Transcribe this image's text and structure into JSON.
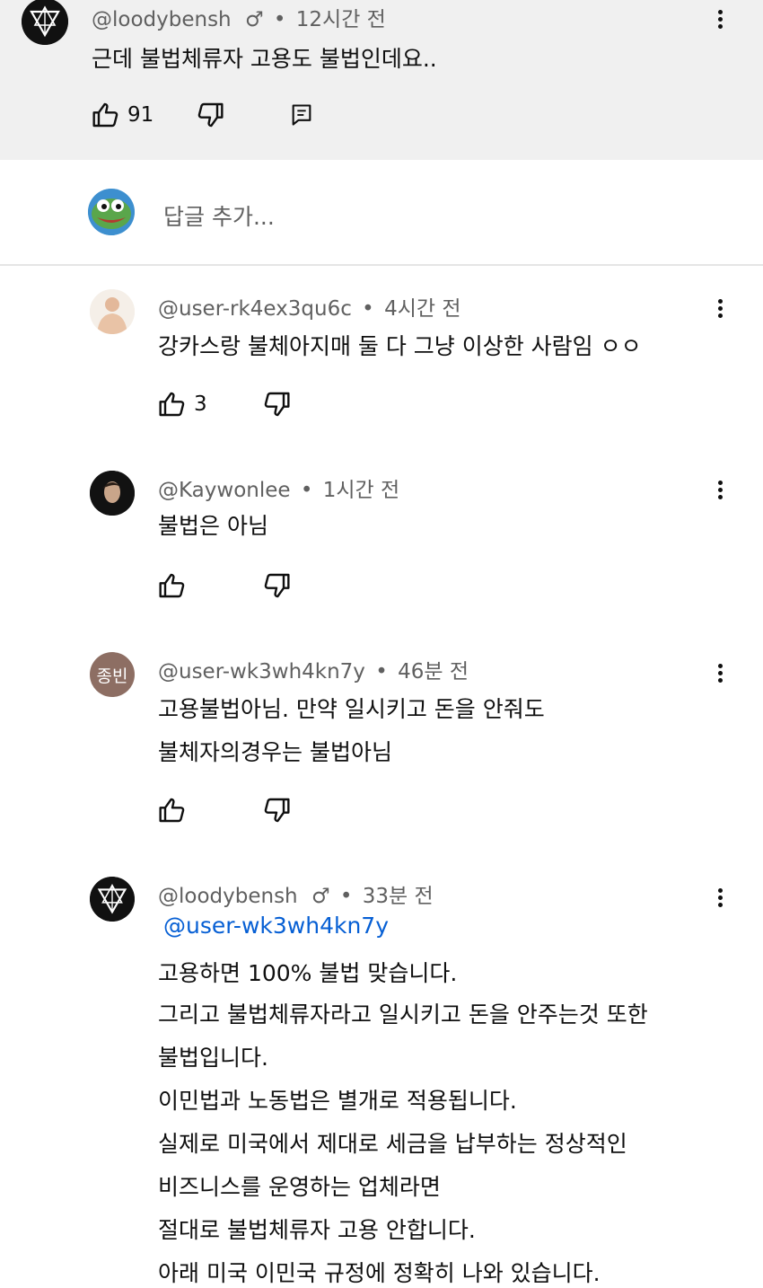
{
  "parent_comment": {
    "author": "@loodybensh",
    "time": "12시간 전",
    "text": "근데 불법체류자 고용도 불법인데요..",
    "likes": "91"
  },
  "reply_box": {
    "placeholder": "답글 추가..."
  },
  "replies": [
    {
      "author": "@user-rk4ex3qu6c",
      "time": "4시간 전",
      "lines": [
        "강카스랑 불체아지매 둘 다 그냥 이상한 사람임 ㅇㅇ"
      ],
      "likes": "3"
    },
    {
      "author": "@Kaywonlee",
      "time": "1시간 전",
      "lines": [
        "불법은 아님"
      ],
      "likes": ""
    },
    {
      "author": "@user-wk3wh4kn7y",
      "avatar_text": "종빈",
      "time": "46분 전",
      "lines": [
        "고용불법아님. 만약 일시키고 돈을 안줘도",
        "불체자의경우는 불법아님"
      ],
      "likes": ""
    },
    {
      "author": "@loodybensh",
      "time": "33분 전",
      "mention": "@user-wk3wh4kn7y",
      "lines": [
        "고용하면 100% 불법 맞습니다.",
        "그리고 불법체류자라고 일시키고 돈을 안주는것 또한",
        "불법입니다.",
        "이민법과 노동법은 별개로 적용됩니다.",
        "실제로 미국에서 제대로 세금을 납부하는 정상적인",
        "비즈니스를 운영하는 업체라면",
        "절대로 불법체류자 고용 안합니다.",
        "아래 미국 이민국 규정에 정확히 나와 있습니다."
      ]
    }
  ],
  "colors": {
    "mention": "#065fd4",
    "meta": "#606060",
    "parent_bg": "#f0f0f0",
    "avatar_brown": "#8d6e63"
  },
  "icons": [
    "like-icon",
    "dislike-icon",
    "reply-icon",
    "more-icon"
  ]
}
